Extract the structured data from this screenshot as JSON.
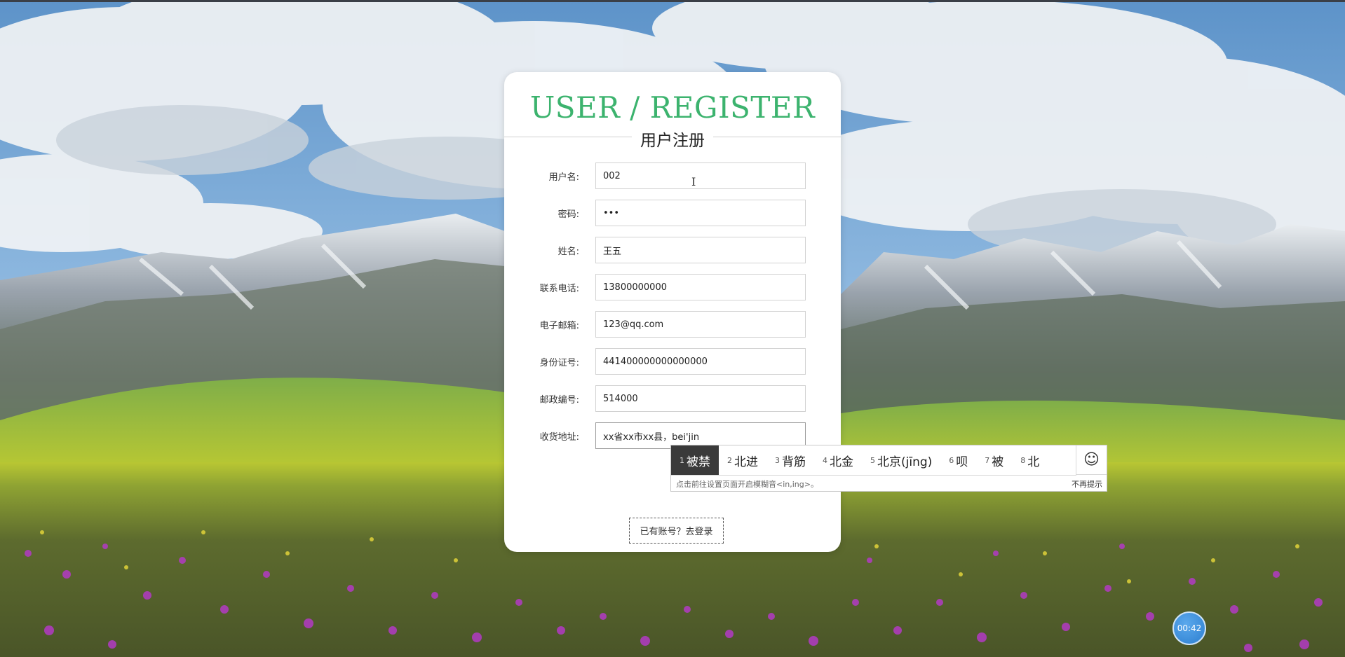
{
  "card": {
    "title": "USER / REGISTER",
    "subtitle": "用户注册"
  },
  "form": {
    "fields": [
      {
        "label": "用户名:",
        "value": "002"
      },
      {
        "label": "密码:",
        "value": "•••"
      },
      {
        "label": "姓名:",
        "value": "王五"
      },
      {
        "label": "联系电话:",
        "value": "13800000000"
      },
      {
        "label": "电子邮箱:",
        "value": "123@qq.com"
      },
      {
        "label": "身份证号:",
        "value": "441400000000000000"
      },
      {
        "label": "邮政编号:",
        "value": "514000"
      },
      {
        "label": "收货地址:",
        "value": "xx省xx市xx县，bei'jin"
      }
    ],
    "login_link": "已有账号？去登录"
  },
  "ime": {
    "candidates": [
      {
        "num": "1",
        "text": "被禁"
      },
      {
        "num": "2",
        "text": "北进"
      },
      {
        "num": "3",
        "text": "背筋"
      },
      {
        "num": "4",
        "text": "北金"
      },
      {
        "num": "5",
        "text": "北京(jīng)"
      },
      {
        "num": "6",
        "text": "呗"
      },
      {
        "num": "7",
        "text": "被"
      },
      {
        "num": "8",
        "text": "北"
      }
    ],
    "emoji_icon": "☺",
    "hint": "点击前往设置页面开启模糊音<in,ing>。",
    "dismiss": "不再提示"
  },
  "timer": "00:42",
  "colors": {
    "title_green": "#3cb36e",
    "ime_selected_bg": "#3a3a3a",
    "timer_blue": "#2d7fd0"
  }
}
